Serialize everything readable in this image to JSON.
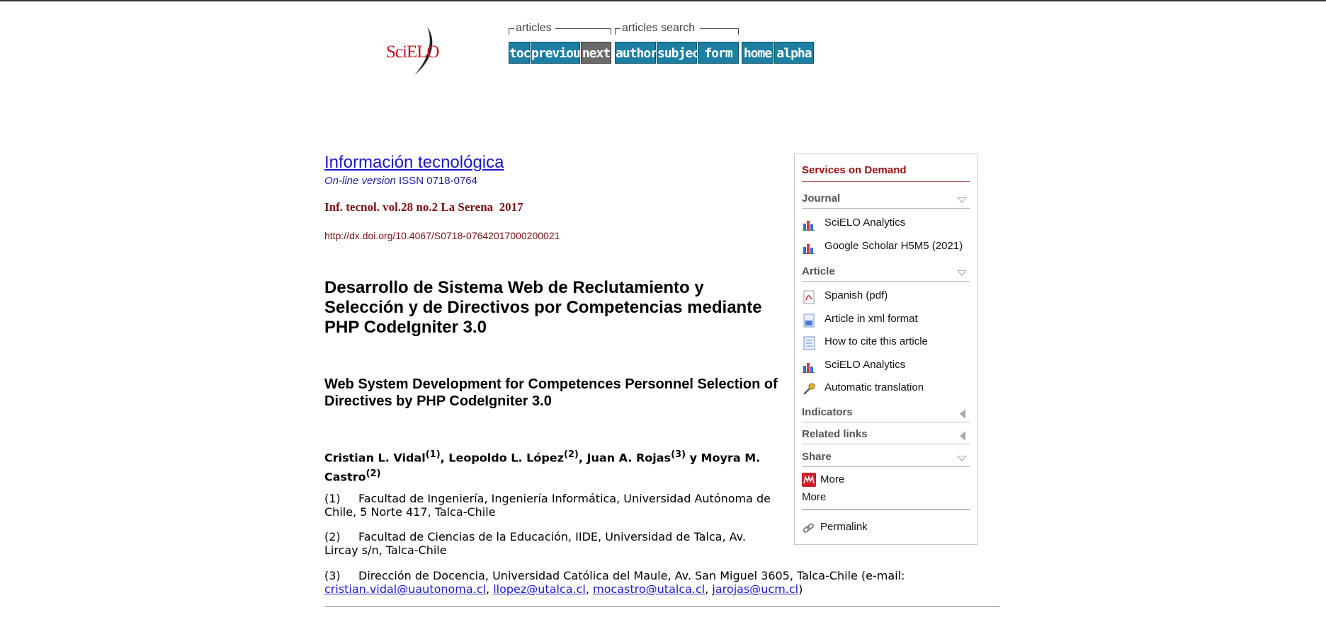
{
  "brand": {
    "logo_text": "SciELO"
  },
  "nav": {
    "articles_label": "articles",
    "search_label": "articles search",
    "buttons": {
      "toc": "toc",
      "previous": "previous",
      "next": "next",
      "author": "author",
      "subject": "subject",
      "form": "form",
      "home": "home",
      "alpha": "alpha"
    }
  },
  "journal": {
    "title": "Información tecnológica",
    "online_version": "On-line version",
    "issn": " ISSN 0718-0764",
    "volume": "Inf. tecnol. vol.28 no.2 La Serena  2017",
    "doi": "http://dx.doi.org/10.4067/S0718-07642017000200021"
  },
  "article": {
    "title_es": "Desarrollo de Sistema Web de Reclutamiento y Selección y de Directivos por Competencias mediante PHP CodeIgniter 3.0",
    "title_en": "Web System Development for Competences Personnel Selection of Directives by PHP CodeIgniter 3.0",
    "authors": [
      {
        "name": "Cristian L. Vidal",
        "ref": "(1)",
        "sep": ", "
      },
      {
        "name": "Leopoldo L. López",
        "ref": "(2)",
        "sep": ", "
      },
      {
        "name": "Juan A. Rojas",
        "ref": "(3)",
        "sep": " y "
      },
      {
        "name": "Moyra M. Castro",
        "ref": "(2)",
        "sep": ""
      }
    ],
    "affiliations": [
      {
        "num": "(1)",
        "text": "Facultad de Ingeniería, Ingeniería Informática, Universidad Autónoma de Chile, 5 Norte 417, Talca-Chile"
      },
      {
        "num": "(2)",
        "text": "Facultad de Ciencias de la Educación, IIDE, Universidad de Talca, Av. Lircay s/n, Talca-Chile"
      },
      {
        "num": "(3)",
        "text": "Dirección de Docencia, Universidad Católica del Maule, Av. San Miguel 3605, Talca-Chile (e-mail:"
      }
    ],
    "emails": [
      "cristian.vidal@uautonoma.cl",
      "llopez@utalca.cl",
      "mocastro@utalca.cl",
      "jarojas@ucm.cl"
    ],
    "email_sep": ", ",
    "email_close": ")"
  },
  "sidebar": {
    "title": "Services on Demand",
    "sections": {
      "journal": "Journal",
      "article": "Article",
      "indicators": "Indicators",
      "related": "Related links",
      "share": "Share"
    },
    "journal_items": [
      "SciELO Analytics",
      "Google Scholar H5M5 (2021)"
    ],
    "article_items": [
      "Spanish (pdf)",
      "Article in xml format",
      " How to cite this article",
      "SciELO Analytics",
      "Automatic translation"
    ],
    "share_items": [
      "More",
      "More"
    ],
    "permalink": "Permalink"
  },
  "colors": {
    "nav_button": "#1d7fa2",
    "nav_disabled": "#6a6a6a",
    "sidebar_title": "#981010",
    "link": "#1a17c8"
  }
}
